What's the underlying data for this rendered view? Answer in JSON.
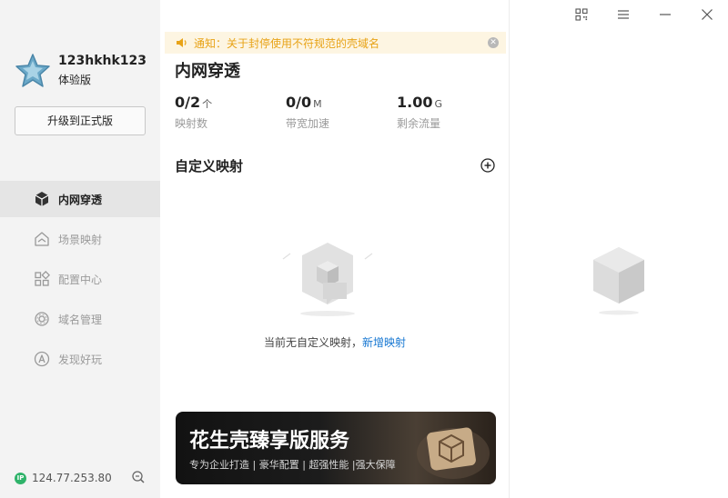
{
  "profile": {
    "username": "123hkhk123",
    "edition": "体验版",
    "upgrade_label": "升级到正式版"
  },
  "nav": {
    "items": [
      {
        "label": "内网穿透",
        "icon": "cube-icon",
        "active": true
      },
      {
        "label": "场景映射",
        "icon": "house-layers-icon",
        "active": false
      },
      {
        "label": "配置中心",
        "icon": "grid-icon",
        "active": false
      },
      {
        "label": "域名管理",
        "icon": "gear-circle-icon",
        "active": false
      },
      {
        "label": "发现好玩",
        "icon": "compass-icon",
        "active": false
      }
    ]
  },
  "status": {
    "ip_badge": "IP",
    "ip": "124.77.253.80"
  },
  "notice": {
    "text": "通知：关于封停使用不符规范的壳域名"
  },
  "main": {
    "title": "内网穿透",
    "stats": [
      {
        "value": "0/2",
        "unit": "个",
        "label": "映射数"
      },
      {
        "value": "0/0",
        "unit": "M",
        "label": "带宽加速"
      },
      {
        "value": "1.00",
        "unit": "G",
        "label": "剩余流量"
      }
    ],
    "section_title": "自定义映射",
    "empty_text": "当前无自定义映射，",
    "empty_link": "新增映射"
  },
  "banner": {
    "title": "花生壳臻享版服务",
    "subtitle": "专为企业打造 | 豪华配置 | 超强性能 |强大保障"
  },
  "colors": {
    "sidebar_bg": "#f3f3f3",
    "accent_link": "#1677d2",
    "notice_text": "#e8a317",
    "notice_bg": "#fdf5e2",
    "ip_status": "#2fb36a"
  }
}
